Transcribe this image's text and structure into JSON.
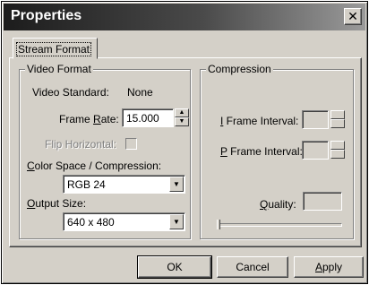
{
  "window": {
    "title": "Properties",
    "close_glyph": "✕"
  },
  "tabs": [
    {
      "label": "Stream Format",
      "selected": true
    }
  ],
  "video_format": {
    "group_label": "Video Format",
    "video_standard_label": "Video Standard:",
    "video_standard_value": "None",
    "frame_rate_label_pre": "Frame ",
    "frame_rate_label_ul": "R",
    "frame_rate_label_post": "ate:",
    "frame_rate_value": "15.000",
    "flip_horizontal_label": "Flip Horizontal:",
    "flip_horizontal_checked": false,
    "color_space_label_ul": "C",
    "color_space_label_post": "olor Space / Compression:",
    "color_space_value": "RGB 24",
    "output_size_label_ul": "O",
    "output_size_label_post": "utput Size:",
    "output_size_value": "640 x 480"
  },
  "compression": {
    "group_label": "Compression",
    "i_frame_label_ul": "I",
    "i_frame_label_post": " Frame Interval:",
    "p_frame_label_ul": "P",
    "p_frame_label_post": " Frame Interval:",
    "quality_label_ul": "Q",
    "quality_label_post": "uality:",
    "quality_slider_level": 0
  },
  "buttons": {
    "ok_label": "OK",
    "cancel_label": "Cancel",
    "apply_label_ul": "A",
    "apply_label_post": "pply"
  },
  "icons": {
    "spin_up": "▲",
    "spin_down": "▼",
    "dropdown": "▼"
  }
}
